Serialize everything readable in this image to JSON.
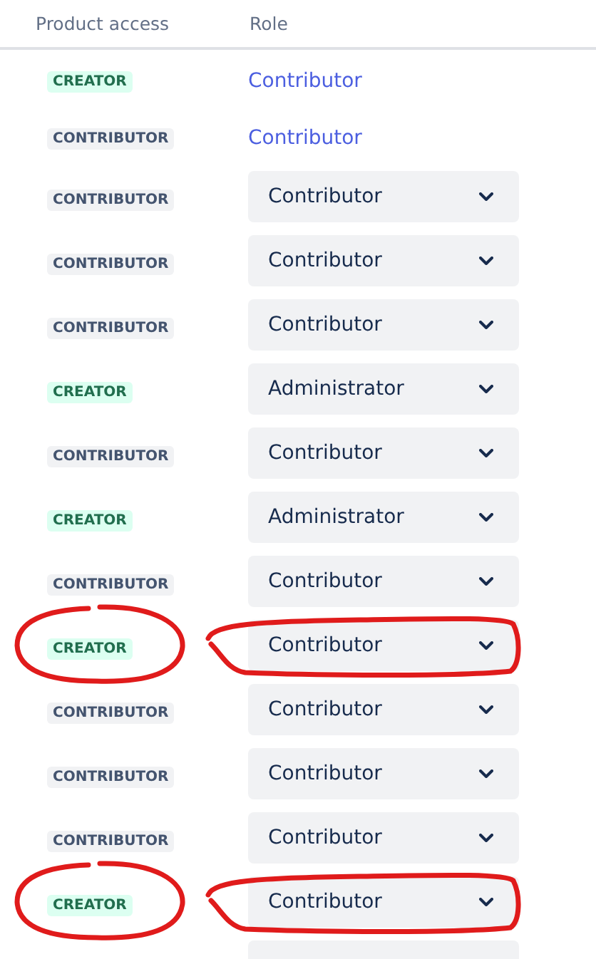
{
  "columns": [
    "Product access",
    "Role"
  ],
  "rows": [
    {
      "kind": "link",
      "access": {
        "text": "CREATOR",
        "kind": "creator"
      },
      "role": "Contributor",
      "annotated": false
    },
    {
      "kind": "link",
      "access": {
        "text": "CONTRIBUTOR",
        "kind": "contributor"
      },
      "role": "Contributor",
      "annotated": false
    },
    {
      "kind": "select",
      "access": {
        "text": "CONTRIBUTOR",
        "kind": "contributor"
      },
      "role": "Contributor",
      "annotated": false
    },
    {
      "kind": "select",
      "access": {
        "text": "CONTRIBUTOR",
        "kind": "contributor"
      },
      "role": "Contributor",
      "annotated": false
    },
    {
      "kind": "select",
      "access": {
        "text": "CONTRIBUTOR",
        "kind": "contributor"
      },
      "role": "Contributor",
      "annotated": false
    },
    {
      "kind": "select",
      "access": {
        "text": "CREATOR",
        "kind": "creator"
      },
      "role": "Administrator",
      "annotated": false
    },
    {
      "kind": "select",
      "access": {
        "text": "CONTRIBUTOR",
        "kind": "contributor"
      },
      "role": "Contributor",
      "annotated": false
    },
    {
      "kind": "select",
      "access": {
        "text": "CREATOR",
        "kind": "creator"
      },
      "role": "Administrator",
      "annotated": false
    },
    {
      "kind": "select",
      "access": {
        "text": "CONTRIBUTOR",
        "kind": "contributor"
      },
      "role": "Contributor",
      "annotated": false
    },
    {
      "kind": "select",
      "access": {
        "text": "CREATOR",
        "kind": "creator"
      },
      "role": "Contributor",
      "annotated": true
    },
    {
      "kind": "select",
      "access": {
        "text": "CONTRIBUTOR",
        "kind": "contributor"
      },
      "role": "Contributor",
      "annotated": false
    },
    {
      "kind": "select",
      "access": {
        "text": "CONTRIBUTOR",
        "kind": "contributor"
      },
      "role": "Contributor",
      "annotated": false
    },
    {
      "kind": "select",
      "access": {
        "text": "CONTRIBUTOR",
        "kind": "contributor"
      },
      "role": "Contributor",
      "annotated": false
    },
    {
      "kind": "select",
      "access": {
        "text": "CREATOR",
        "kind": "creator"
      },
      "role": "Contributor",
      "annotated": true
    },
    {
      "kind": "select",
      "annotated": false
    }
  ]
}
